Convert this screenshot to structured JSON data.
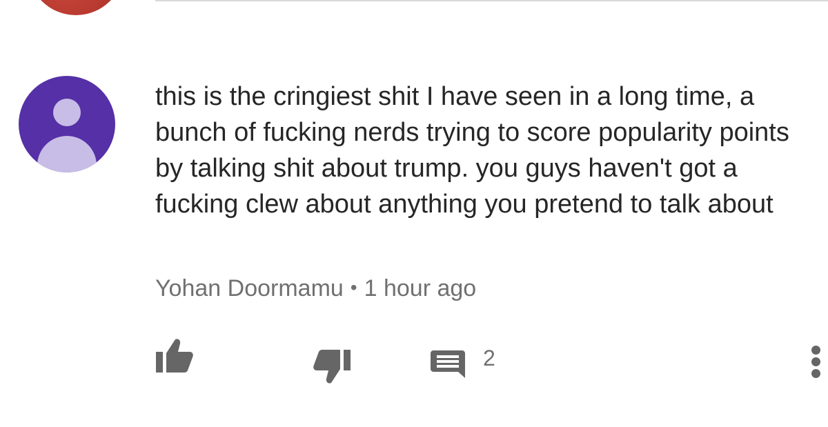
{
  "comment": {
    "text": "this is the cringiest shit I have seen in a long time, a bunch of fucking nerds trying to score popularity points by talking shit about trump. you guys haven't got a fucking clew about anything you pretend to talk about",
    "author": "Yohan Doormamu",
    "separator": "•",
    "timestamp": "1 hour ago",
    "reply_count": "2",
    "avatar_color": "#5530a6",
    "icons": [
      "thumbs-up-icon",
      "thumbs-down-icon",
      "reply-icon",
      "more-vert-icon"
    ]
  },
  "colors": {
    "text": "#262626",
    "meta": "#707070",
    "icon": "#666666",
    "divider": "#d9d9d9",
    "previous_avatar": "#b83a30"
  }
}
